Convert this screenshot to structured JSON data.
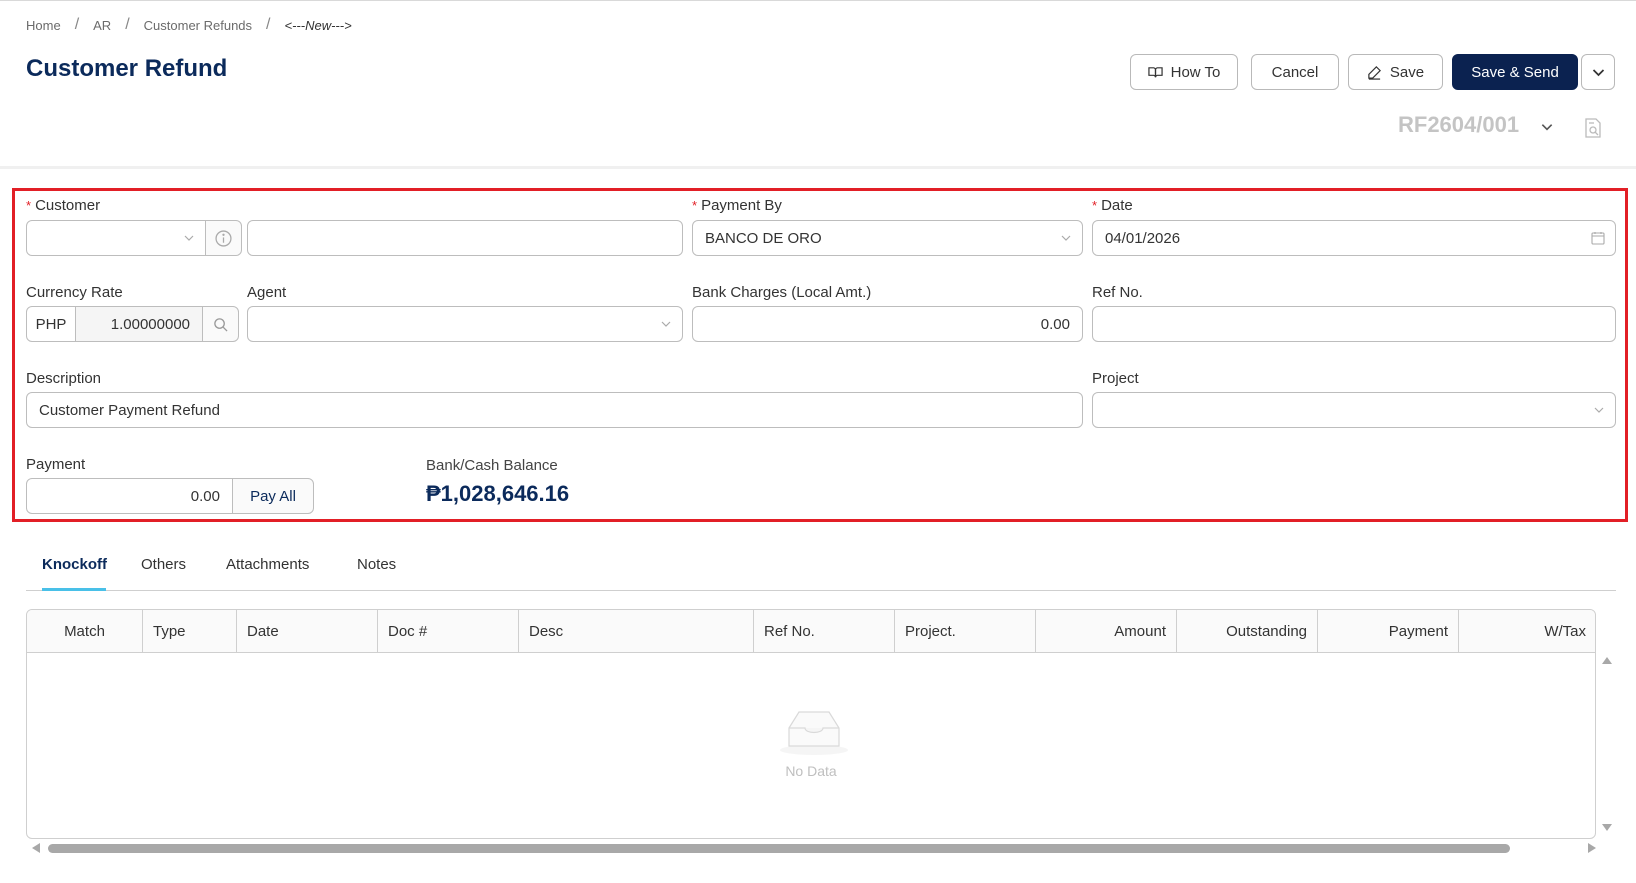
{
  "breadcrumb": [
    "Home",
    "AR",
    "Customer Refunds",
    "<---New--->"
  ],
  "page_title": "Customer Refund",
  "toolbar": {
    "howto_label": "How To",
    "cancel_label": "Cancel",
    "save_label": "Save",
    "save_send_label": "Save & Send"
  },
  "doc_number": "RF2604/001",
  "form": {
    "customer_label": "Customer",
    "customer_code": "",
    "customer_name": "",
    "payment_by_label": "Payment By",
    "payment_by_value": "BANCO DE ORO",
    "date_label": "Date",
    "date_value": "04/01/2026",
    "currency_rate_label": "Currency Rate",
    "currency_code": "PHP",
    "currency_rate_value": "1.00000000",
    "agent_label": "Agent",
    "agent_value": "",
    "bank_charges_label": "Bank Charges (Local Amt.)",
    "bank_charges_value": "0.00",
    "ref_no_label": "Ref No.",
    "ref_no_value": "",
    "description_label": "Description",
    "description_value": "Customer Payment Refund",
    "project_label": "Project",
    "project_value": "",
    "payment_label": "Payment",
    "payment_value": "0.00",
    "pay_all_label": "Pay All",
    "balance_label": "Bank/Cash Balance",
    "balance_value": "₱1,028,646.16"
  },
  "tabs": [
    "Knockoff",
    "Others",
    "Attachments",
    "Notes"
  ],
  "table": {
    "columns": [
      "Match",
      "Type",
      "Date",
      "Doc #",
      "Desc",
      "Ref No.",
      "Project.",
      "Amount",
      "Outstanding",
      "Payment",
      "W/Tax"
    ],
    "empty_text": "No Data"
  },
  "colors": {
    "accent": "#0b2250",
    "title": "#0b2a5b",
    "highlight": "#e21f26",
    "tab_underline": "#49c0e8"
  },
  "icons": [
    "book-icon",
    "edit-icon",
    "chevron-down-icon",
    "info-icon",
    "search-icon",
    "calendar-icon",
    "document-search-icon",
    "empty-inbox-icon"
  ]
}
